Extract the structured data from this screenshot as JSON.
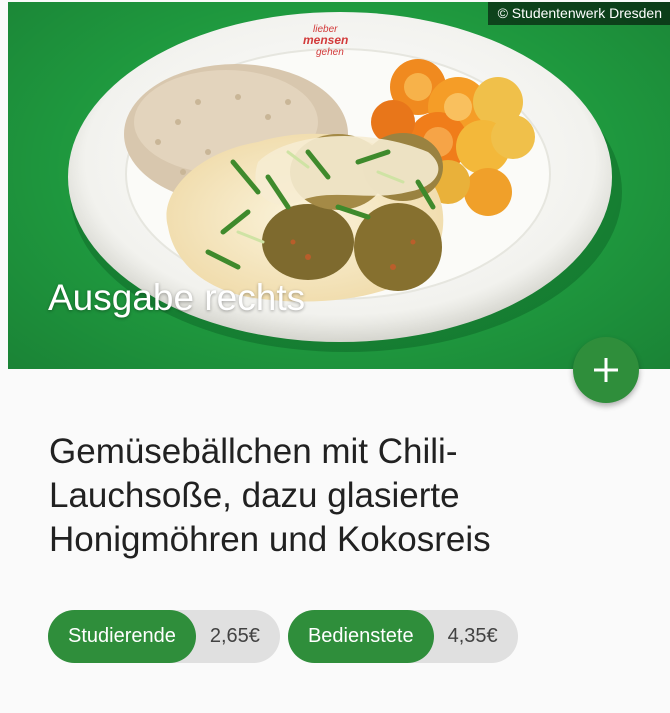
{
  "image": {
    "copyright": "© Studentenwerk Dresden",
    "location": "Ausgabe rechts",
    "plate_text": [
      "lieber",
      "mensen",
      "gehen"
    ],
    "background_color": "#1f9a3f"
  },
  "fab": {
    "icon": "plus-icon",
    "color": "#2f8e3b"
  },
  "meal": {
    "title": "Gemüsebällchen mit Chili-Lauchsoße, dazu glasierte Honigmöhren und Kokosreis"
  },
  "prices": [
    {
      "label": "Studierende",
      "value": "2,65€"
    },
    {
      "label": "Bedienstete",
      "value": "4,35€"
    }
  ],
  "colors": {
    "accent": "#2f8e3b",
    "chip_bg": "#e0e0e0"
  }
}
